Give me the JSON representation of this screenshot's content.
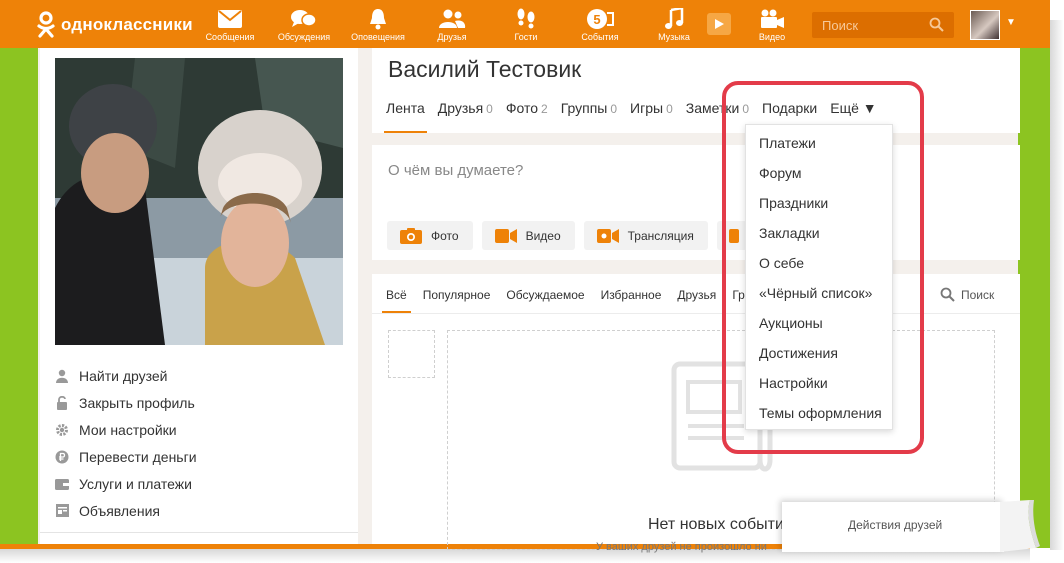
{
  "brand": {
    "name": "одноклассники"
  },
  "nav": [
    {
      "label": "Сообщения",
      "icon": "envelope-icon"
    },
    {
      "label": "Обсуждения",
      "icon": "discussions-icon"
    },
    {
      "label": "Оповещения",
      "icon": "bell-icon"
    },
    {
      "label": "Друзья",
      "icon": "friends-icon"
    },
    {
      "label": "Гости",
      "icon": "footprints-icon"
    },
    {
      "label": "События",
      "icon": "events-icon",
      "badge": "5"
    },
    {
      "label": "Музыка",
      "icon": "music-note-icon"
    },
    {
      "label": "Видео",
      "icon": "video-camera-icon"
    }
  ],
  "search": {
    "placeholder": "Поиск"
  },
  "profile": {
    "name": "Василий Тестовик",
    "tabs": [
      {
        "label": "Лента",
        "count": "",
        "active": true
      },
      {
        "label": "Друзья",
        "count": "0"
      },
      {
        "label": "Фото",
        "count": "2"
      },
      {
        "label": "Группы",
        "count": "0"
      },
      {
        "label": "Игры",
        "count": "0"
      },
      {
        "label": "Заметки",
        "count": "0"
      },
      {
        "label": "Подарки",
        "count": ""
      },
      {
        "label": "Ещё ▼",
        "count": ""
      }
    ]
  },
  "left_links": [
    {
      "label": "Найти друзей",
      "icon": "person-icon"
    },
    {
      "label": "Закрыть профиль",
      "icon": "unlock-icon"
    },
    {
      "label": "Мои настройки",
      "icon": "gear-icon"
    },
    {
      "label": "Перевести деньги",
      "icon": "ruble-icon"
    },
    {
      "label": "Услуги и платежи",
      "icon": "wallet-icon"
    },
    {
      "label": "Объявления",
      "icon": "ads-icon"
    }
  ],
  "composer": {
    "placeholder": "О чём вы думаете?",
    "buttons": [
      {
        "label": "Фото",
        "icon": "camera-icon"
      },
      {
        "label": "Видео",
        "icon": "video-icon"
      },
      {
        "label": "Трансляция",
        "icon": "broadcast-icon"
      }
    ]
  },
  "feed": {
    "tabs": [
      {
        "label": "Всё",
        "active": true
      },
      {
        "label": "Популярное"
      },
      {
        "label": "Обсуждаемое"
      },
      {
        "label": "Избранное"
      },
      {
        "label": "Друзья"
      },
      {
        "label": "Гр"
      }
    ],
    "search_label": "Поиск",
    "empty_title": "Нет новых событи",
    "empty_subtitle": "У ваших друзей не произошло ни"
  },
  "dropdown": {
    "items": [
      "Платежи",
      "Форум",
      "Праздники",
      "Закладки",
      "О себе",
      "«Чёрный список»",
      "Аукционы",
      "Достижения",
      "Настройки",
      "Темы оформления"
    ]
  },
  "friends_actions": {
    "label": "Действия друзей"
  },
  "colors": {
    "brand": "#ee8208",
    "accent_green": "#8cc421",
    "highlight": "#e33b49"
  }
}
